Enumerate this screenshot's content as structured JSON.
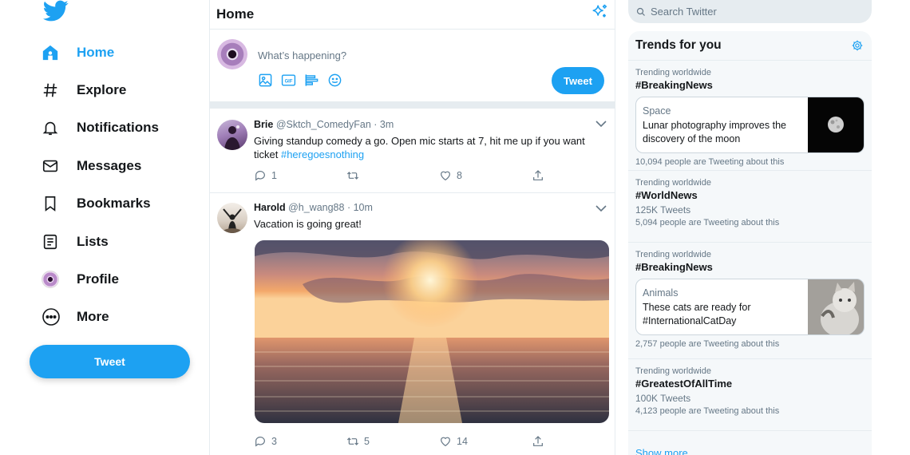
{
  "sidebar": {
    "items": [
      {
        "label": "Home",
        "icon": "home-icon",
        "active": true
      },
      {
        "label": "Explore",
        "icon": "hashtag-icon"
      },
      {
        "label": "Notifications",
        "icon": "bell-icon"
      },
      {
        "label": "Messages",
        "icon": "envelope-icon"
      },
      {
        "label": "Bookmarks",
        "icon": "bookmark-icon"
      },
      {
        "label": "Lists",
        "icon": "list-icon"
      },
      {
        "label": "Profile",
        "icon": "avatar"
      },
      {
        "label": "More",
        "icon": "more-circle-icon"
      }
    ],
    "tweet_button": "Tweet"
  },
  "feed": {
    "title": "Home",
    "compose": {
      "placeholder": "What’s happening?",
      "tweet_button": "Tweet",
      "icons": [
        "image-icon",
        "gif-icon",
        "poll-icon",
        "emoji-icon"
      ]
    },
    "tweets": [
      {
        "name": "Brie",
        "handle": "@Sktch_ComedyFan",
        "time": "· 3m",
        "text": "Giving standup comedy a go. Open mic starts at 7, hit me up if you want ticket ",
        "hashtag": "#heregoesnothing",
        "replies": "1",
        "retweets": "",
        "likes": "8"
      },
      {
        "name": "Harold",
        "handle": "@h_wang88",
        "time": "· 10m",
        "text": "Vacation is going great!",
        "replies": "3",
        "retweets": "5",
        "likes": "14"
      }
    ]
  },
  "search": {
    "placeholder": "Search Twitter"
  },
  "trends": {
    "title": "Trends for you",
    "items": [
      {
        "context": "Trending worldwide",
        "tag": "#BreakingNews",
        "card_category": "Space",
        "card_text": "Lunar photography improves the discovery of the moon",
        "people": "10,094 people are Tweeting about this"
      },
      {
        "context": "Trending worldwide",
        "tag": "#WorldNews",
        "count": "125K Tweets",
        "people": "5,094 people are Tweeting about this"
      },
      {
        "context": "Trending worldwide",
        "tag": "#BreakingNews",
        "card_category": "Animals",
        "card_text": "These cats are ready for #InternationalCatDay",
        "people": "2,757 people are Tweeting about this"
      },
      {
        "context": "Trending worldwide",
        "tag": "#GreatestOfAllTime",
        "count": "100K Tweets",
        "people": "4,123 people are Tweeting about this"
      }
    ],
    "show_more": "Show more"
  },
  "colors": {
    "accent": "#1da1f2",
    "text": "#14171a",
    "secondary": "#657786",
    "border": "#e6ecf0",
    "panel": "#f5f8fa"
  }
}
